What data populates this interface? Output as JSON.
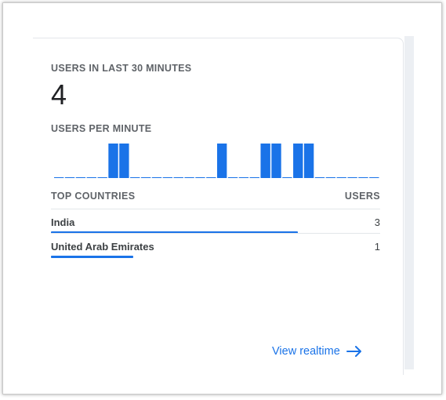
{
  "card": {
    "users_title": "USERS IN LAST 30 MINUTES",
    "users_count": "4",
    "per_minute_title": "USERS PER MINUTE",
    "link_label": "View realtime",
    "link_icon": "arrow-right-icon"
  },
  "countries": {
    "header_country": "TOP COUNTRIES",
    "header_users": "USERS",
    "rows": [
      {
        "name": "India",
        "users": "3",
        "share": 0.75
      },
      {
        "name": "United Arab Emirates",
        "users": "1",
        "share": 0.25
      }
    ]
  },
  "colors": {
    "accent": "#1a73e8",
    "text_muted": "#5f6368",
    "text_dark": "#202124"
  },
  "chart_data": {
    "type": "bar",
    "minutes": 30,
    "values": [
      0,
      0,
      0,
      0,
      0,
      1,
      1,
      0,
      0,
      0,
      0,
      0,
      0,
      0,
      0,
      1,
      0,
      0,
      0,
      1,
      1,
      0,
      1,
      1,
      0,
      0,
      0,
      0,
      0,
      0
    ]
  }
}
